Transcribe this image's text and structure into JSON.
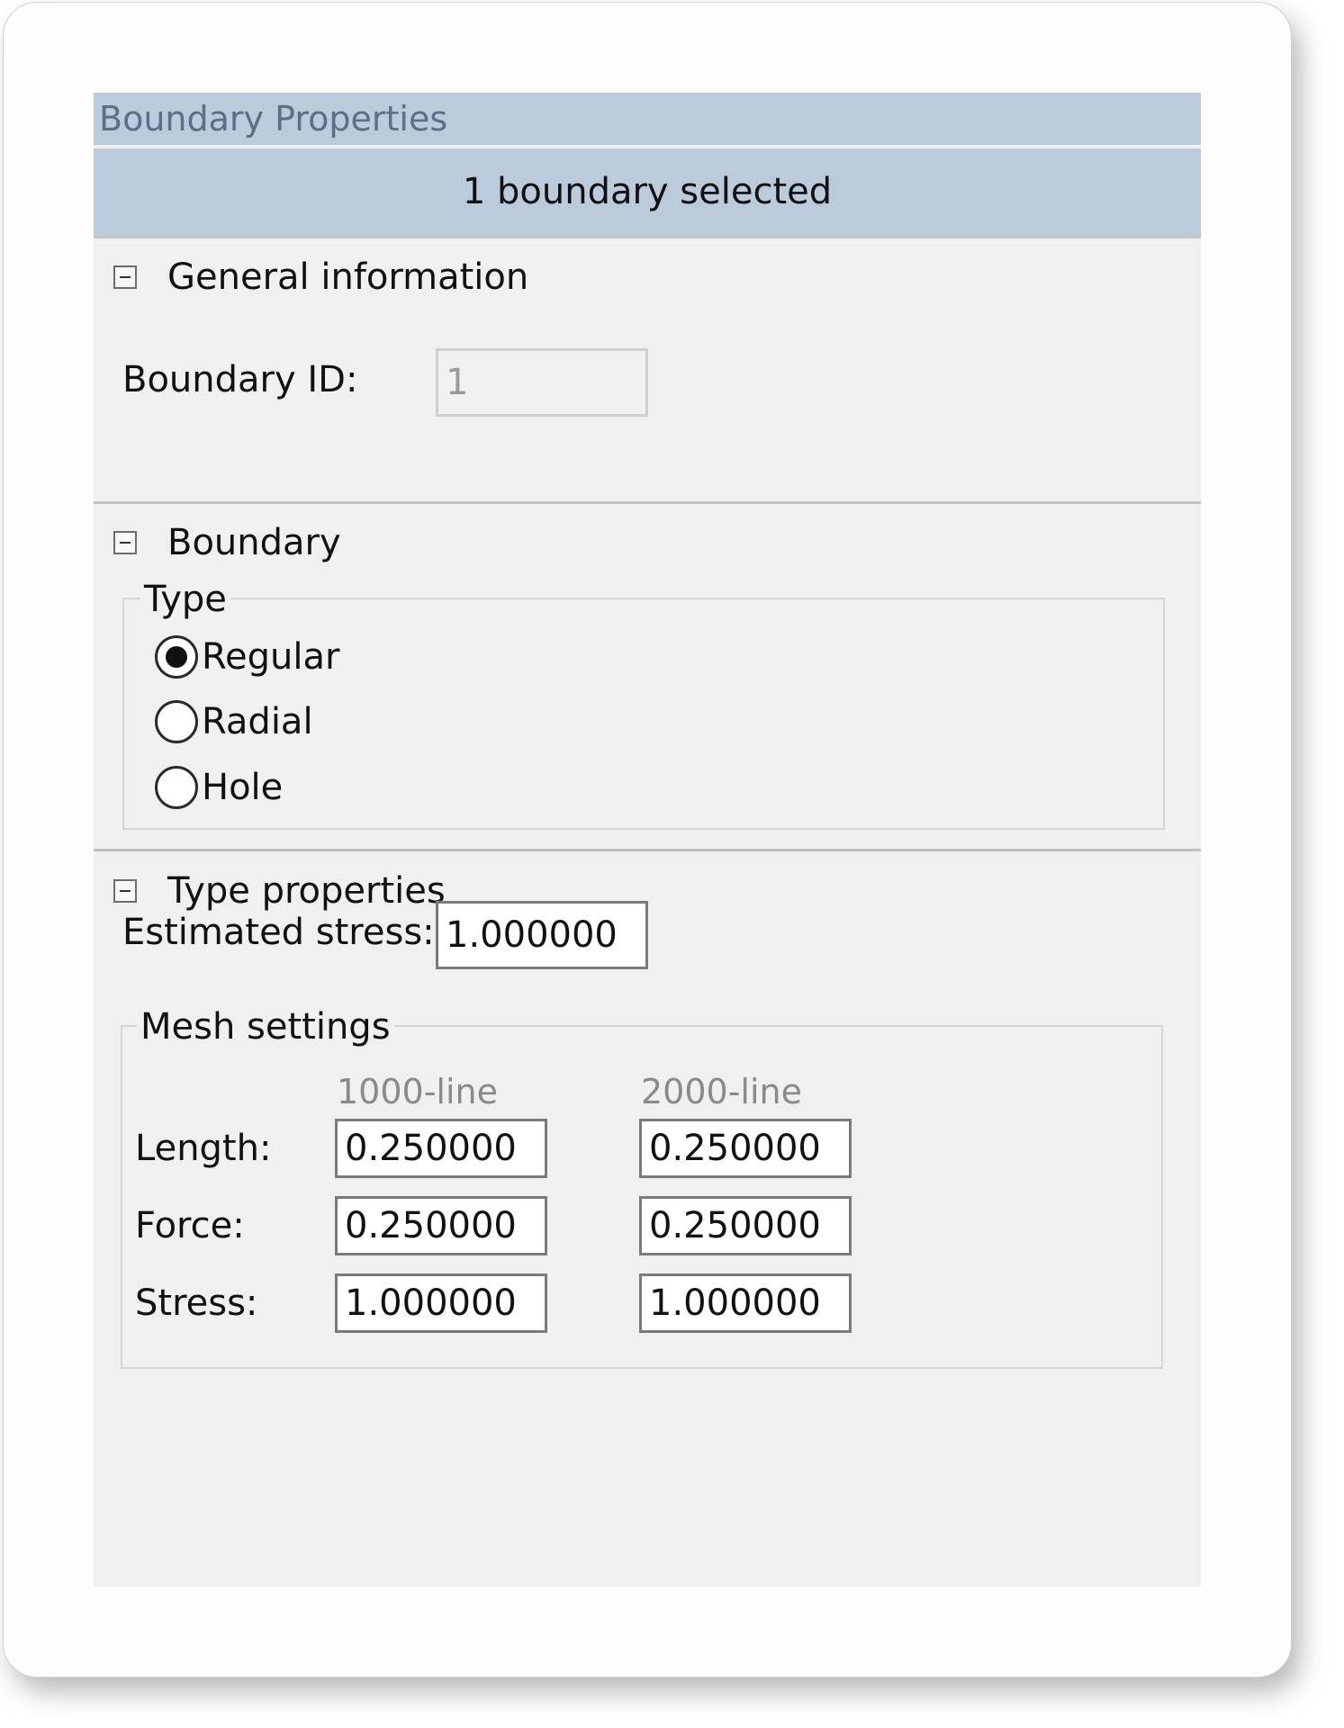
{
  "panel": {
    "title": "Boundary Properties",
    "selection": "1 boundary selected"
  },
  "general": {
    "header": "General information",
    "boundary_id_label": "Boundary ID:",
    "boundary_id_value": "1"
  },
  "boundary": {
    "header": "Boundary",
    "type_group": "Type",
    "options": [
      {
        "label": "Regular",
        "checked": true
      },
      {
        "label": "Radial",
        "checked": false
      },
      {
        "label": "Hole",
        "checked": false
      }
    ]
  },
  "type_props": {
    "header": "Type properties",
    "estimated_stress_label": "Estimated stress:",
    "estimated_stress_value": "1.000000",
    "mesh": {
      "group": "Mesh settings",
      "col1": "1000-line",
      "col2": "2000-line",
      "rows": [
        {
          "label": "Length:",
          "v1": "0.250000",
          "v2": "0.250000"
        },
        {
          "label": "Force:",
          "v1": "0.250000",
          "v2": "0.250000"
        },
        {
          "label": "Stress:",
          "v1": "1.000000",
          "v2": "1.000000"
        }
      ]
    }
  }
}
